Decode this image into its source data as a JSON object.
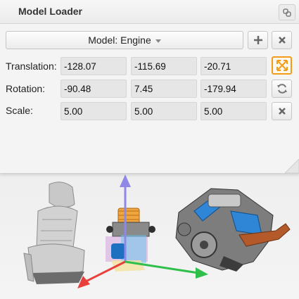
{
  "window": {
    "title": "Model Loader"
  },
  "model": {
    "select_label": "Model: Engine"
  },
  "translation": {
    "label": "Translation:",
    "x": "-128.07",
    "y": "-115.69",
    "z": "-20.71"
  },
  "rotation": {
    "label": "Rotation:",
    "x": "-90.48",
    "y": "7.45",
    "z": "-179.94"
  },
  "scale": {
    "label": "Scale:",
    "x": "5.00",
    "y": "5.00",
    "z": "5.00"
  },
  "icons": {
    "link": "link-icon",
    "add": "plus-icon",
    "remove": "close-icon",
    "translate_tool": "move-arrows-icon",
    "rotate_tool": "refresh-icon",
    "scale_reset": "close-icon"
  },
  "colors": {
    "accent": "#f39c1b",
    "axis_x": "#e8403c",
    "axis_y": "#8f88e6",
    "axis_z": "#2fbf4a",
    "engine_blue": "#2f86d6"
  }
}
